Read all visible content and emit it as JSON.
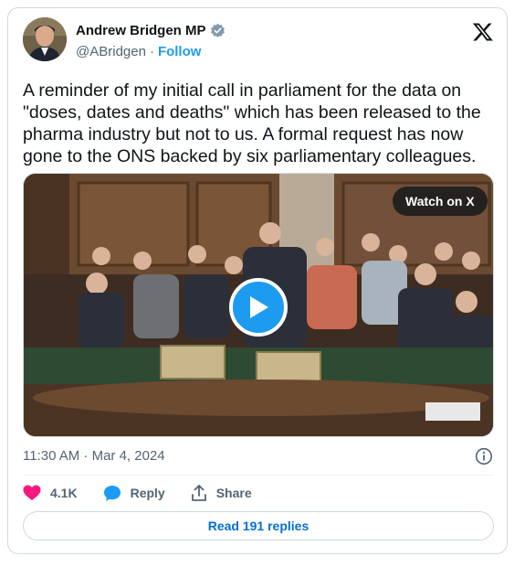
{
  "author": {
    "name": "Andrew Bridgen MP",
    "handle": "@ABridgen",
    "separator": "·",
    "follow_label": "Follow",
    "avatar_icon": "profile-photo"
  },
  "tweet": {
    "text": "A reminder of my initial call in parliament for the data on\n\"doses, dates and deaths\" which has been released to the\npharma industry but not to us. A formal request has now\ngone to the ONS backed by six parliamentary colleagues.",
    "timestamp": "11:30 AM · Mar 4, 2024"
  },
  "media": {
    "watch_label": "Watch on X",
    "play_icon": "play-icon"
  },
  "actions": {
    "like_count": "4.1K",
    "reply_label": "Reply",
    "share_label": "Share"
  },
  "footer": {
    "read_replies_label": "Read 191 replies"
  },
  "colors": {
    "accent": "#1d9bf0",
    "like": "#f91880",
    "text": "#0f1419",
    "muted": "#536471",
    "border": "#cfd9de"
  }
}
